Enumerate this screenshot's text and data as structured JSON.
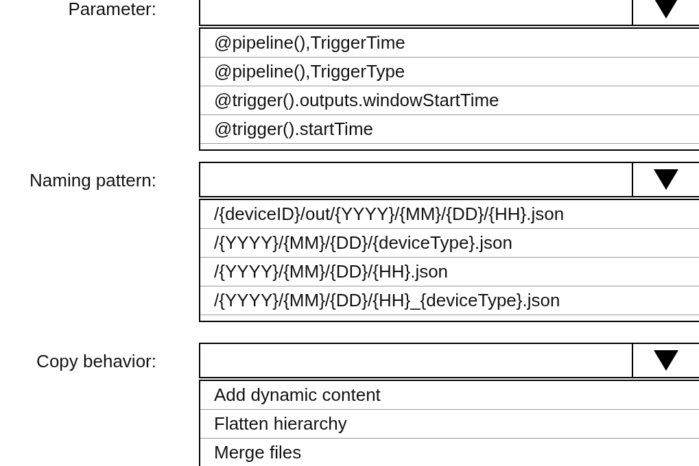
{
  "groups": [
    {
      "label": "Parameter:",
      "options": [
        "@pipeline(),TriggerTime",
        "@pipeline(),TriggerType",
        "@trigger().outputs.windowStartTime",
        "@trigger().startTime"
      ]
    },
    {
      "label": "Naming pattern:",
      "options": [
        "/{deviceID}/out/{YYYY}/{MM}/{DD}/{HH}.json",
        "/{YYYY}/{MM}/{DD}/{deviceType}.json",
        "/{YYYY}/{MM}/{DD}/{HH}.json",
        "/{YYYY}/{MM}/{DD}/{HH}_{deviceType}.json"
      ]
    },
    {
      "label": "Copy behavior:",
      "options": [
        "Add dynamic content",
        "Flatten hierarchy",
        "Merge files"
      ]
    }
  ]
}
